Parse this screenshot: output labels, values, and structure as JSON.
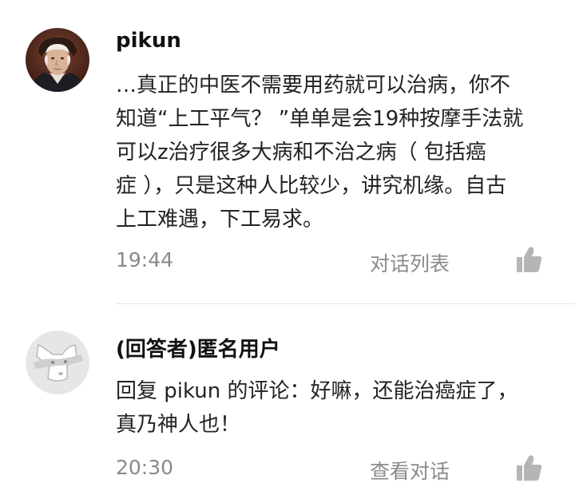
{
  "comments": [
    {
      "avatar_icon": "portrait-avatar",
      "username": "pikun",
      "text_lines": [
        "…真正的中医不需要用药就可以治病，你不",
        "知道“上工平气？ ”单单是会19种按摩手法就",
        "可以z治疗很多大病和不治之病（ 包括癌",
        "症 ），只是这种人比较少，讲究机缘。自古",
        "上工难遇，下工易求。"
      ],
      "time": "19:44",
      "action_label": "对话列表",
      "like_icon": "thumbs-up-icon"
    },
    {
      "avatar_icon": "anonymous-mask-avatar",
      "username": "(回答者)匿名用户",
      "text_lines": [
        "回复 pikun 的评论：好嘛，还能治癌症了，",
        "真乃神人也！"
      ],
      "time": "20:30",
      "action_label": "查看对话",
      "like_icon": "thumbs-up-icon"
    }
  ],
  "colors": {
    "text_primary": "#222222",
    "text_secondary": "#8a8a8a",
    "icon_gray": "#b5b5b5",
    "divider": "#e4e4e4"
  }
}
